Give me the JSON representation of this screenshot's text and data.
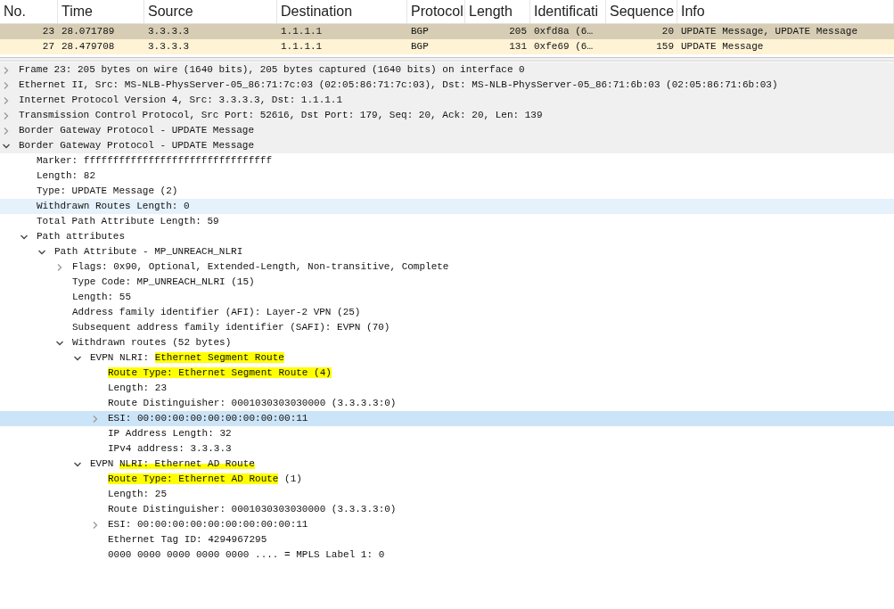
{
  "packet_list": {
    "columns": [
      "No.",
      "Time",
      "Source",
      "Destination",
      "Protocol",
      "Length",
      "Identificati",
      "Sequence",
      "Info"
    ],
    "rows": [
      {
        "selected": true,
        "cells": [
          "23",
          "28.071789",
          "3.3.3.3",
          "1.1.1.1",
          "BGP",
          "205",
          "0xfd8a (6…",
          "20",
          "UPDATE Message, UPDATE Message"
        ]
      },
      {
        "selected": false,
        "cells": [
          "27",
          "28.479708",
          "3.3.3.3",
          "1.1.1.1",
          "BGP",
          "131",
          "0xfe69 (6…",
          "159",
          "UPDATE Message"
        ]
      }
    ]
  },
  "details": [
    {
      "text": "Frame 23: 205 bytes on wire (1640 bits), 205 bytes captured (1640 bits) on interface 0",
      "expanded": false,
      "selected": false
    },
    {
      "text": "Ethernet II, Src: MS-NLB-PhysServer-05_86:71:7c:03 (02:05:86:71:7c:03), Dst: MS-NLB-PhysServer-05_86:71:6b:03 (02:05:86:71:6b:03)",
      "expanded": false,
      "selected": false
    },
    {
      "text": "Internet Protocol Version 4, Src: 3.3.3.3, Dst: 1.1.1.1",
      "expanded": false,
      "selected": false
    },
    {
      "text": "Transmission Control Protocol, Src Port: 52616, Dst Port: 179, Seq: 20, Ack: 20, Len: 139",
      "expanded": false,
      "selected": false
    },
    {
      "text": "Border Gateway Protocol - UPDATE Message",
      "expanded": false,
      "selected": false
    },
    {
      "text": "Border Gateway Protocol - UPDATE Message",
      "expanded": true,
      "selected": false,
      "children": [
        {
          "text": "Marker: ffffffffffffffffffffffffffffffff",
          "selected": false
        },
        {
          "text": "Length: 82",
          "selected": false
        },
        {
          "text": "Type: UPDATE Message (2)",
          "selected": false
        },
        {
          "text": "Withdrawn Routes Length: 0",
          "selected": false,
          "hovered": true
        },
        {
          "text": "Total Path Attribute Length: 59",
          "selected": false
        },
        {
          "text": "Path attributes",
          "expanded": true,
          "selected": false,
          "children": [
            {
              "text": "Path Attribute - MP_UNREACH_NLRI",
              "expanded": true,
              "selected": false,
              "children": [
                {
                  "text": "Flags: 0x90, Optional, Extended-Length, Non-transitive, Complete",
                  "expanded": false,
                  "selected": false
                },
                {
                  "text": "Type Code: MP_UNREACH_NLRI (15)",
                  "selected": false
                },
                {
                  "text": "Length: 55",
                  "selected": false
                },
                {
                  "text": "Address family identifier (AFI): Layer-2 VPN (25)",
                  "selected": false
                },
                {
                  "text": "Subsequent address family identifier (SAFI): EVPN (70)",
                  "selected": false
                },
                {
                  "text": "Withdrawn routes (52 bytes)",
                  "expanded": true,
                  "selected": false,
                  "children": [
                    {
                      "segments": [
                        {
                          "text": "EVPN NLRI: ",
                          "highlighted": false
                        },
                        {
                          "text": "Ethernet Segment Route",
                          "highlighted": true
                        }
                      ],
                      "expanded": true,
                      "selected": false,
                      "children": [
                        {
                          "segments": [
                            {
                              "text": "Route Type: Ethernet Segment Route (4)",
                              "highlighted": true
                            }
                          ],
                          "selected": false
                        },
                        {
                          "text": "Length: 23",
                          "selected": false
                        },
                        {
                          "text": "Route Distinguisher: 0001030303030000 (3.3.3.3:0)",
                          "selected": false
                        },
                        {
                          "text": "ESI: 00:00:00:00:00:00:00:00:00:11",
                          "expanded": false,
                          "selected": true
                        },
                        {
                          "text": "IP Address Length: 32",
                          "selected": false
                        },
                        {
                          "text": "IPv4 address: 3.3.3.3",
                          "selected": false
                        }
                      ]
                    },
                    {
                      "segments": [
                        {
                          "text": "EVPN ",
                          "highlighted": false
                        },
                        {
                          "text": "NLRI: Ethernet AD Route",
                          "highlighted": true,
                          "lower_half": true
                        }
                      ],
                      "expanded": true,
                      "selected": false,
                      "children": [
                        {
                          "segments": [
                            {
                              "text": "Route Type: Ethernet AD Route",
                              "highlighted": true
                            },
                            {
                              "text": " (1)",
                              "highlighted": false
                            }
                          ],
                          "selected": false
                        },
                        {
                          "text": "Length: 25",
                          "selected": false
                        },
                        {
                          "text": "Route Distinguisher: 0001030303030000 (3.3.3.3:0)",
                          "selected": false
                        },
                        {
                          "text": "ESI: 00:00:00:00:00:00:00:00:00:11",
                          "expanded": false,
                          "selected": false
                        },
                        {
                          "text": "Ethernet Tag ID: 4294967295",
                          "selected": false
                        },
                        {
                          "text": "0000 0000 0000 0000 0000 .... = MPLS Label 1: 0",
                          "selected": false
                        }
                      ]
                    }
                  ]
                }
              ]
            }
          ]
        }
      ]
    }
  ]
}
